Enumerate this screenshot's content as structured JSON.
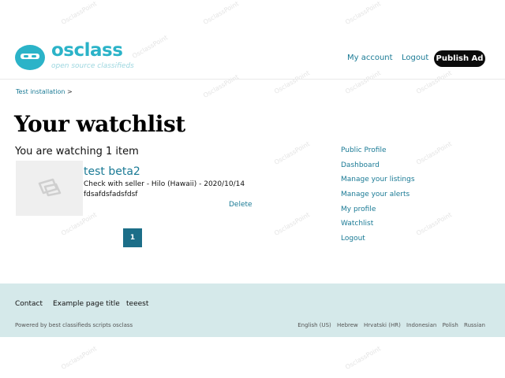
{
  "header": {
    "logo": {
      "word": "osclass",
      "tagline": "open source classifieds",
      "color": "#2bb3c8"
    },
    "nav": {
      "my_account": "My account",
      "logout": "Logout",
      "publish": "Publish Ad"
    }
  },
  "breadcrumb": {
    "home": "Test installation",
    "separator": ">"
  },
  "main": {
    "title": "Your watchlist",
    "subtitle": "You are watching 1 item",
    "items": [
      {
        "title": "test beta2",
        "meta": "Check with seller - Hilo (Hawaii) - 2020/10/14",
        "description": "fdsafdsfadsfdsf",
        "delete_label": "Delete",
        "thumbnail_icon": "image-placeholder-icon"
      }
    ],
    "pagination": {
      "current_page": "1"
    }
  },
  "sidebar": {
    "items": [
      "Public Profile",
      "Dashboard",
      "Manage your listings",
      "Manage your alerts",
      "My profile",
      "Watchlist",
      "Logout"
    ]
  },
  "footer": {
    "links": [
      "Contact",
      "Example page title",
      "teeest"
    ],
    "powered_by": "Powered by best classifieds scripts osclass",
    "languages": [
      "English (US)",
      "Hebrew",
      "Hrvatski (HR)",
      "Indonesian",
      "Polish",
      "Russian"
    ],
    "background": "#d5e9ea"
  },
  "watermark": "OsclassPoint",
  "colors": {
    "accent": "#1a7a95",
    "button_dark": "#0b0b0b",
    "pager": "#1c6e88"
  }
}
